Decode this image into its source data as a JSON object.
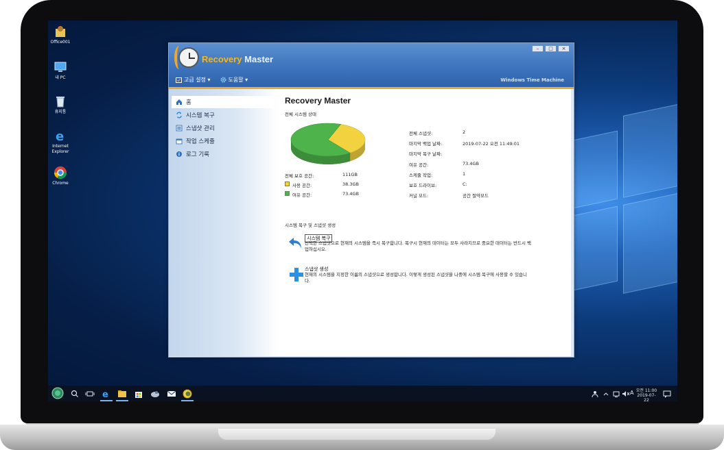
{
  "desktop": {
    "icons": [
      {
        "label": "Office001"
      },
      {
        "label": "내 PC"
      },
      {
        "label": "휴지통"
      },
      {
        "label": "Internet Explorer"
      },
      {
        "label": "Chrome"
      }
    ]
  },
  "app": {
    "title_part1": "Recovery",
    "title_part2": " Master",
    "tagline": "Windows Time Machine",
    "menu": [
      {
        "label": "고급 설정 ▾"
      },
      {
        "label": "도움말 ▾"
      }
    ],
    "window_controls": [
      "–",
      "□",
      "×"
    ]
  },
  "sidebar": {
    "items": [
      {
        "label": "홈",
        "active": true
      },
      {
        "label": "시스템 복구"
      },
      {
        "label": "스냅샷 관리"
      },
      {
        "label": "작업 스케줄"
      },
      {
        "label": "로그 기록"
      }
    ]
  },
  "main": {
    "title": "Recovery Master",
    "status_section": "전체 시스템 상태",
    "disk": {
      "total_label": "전체 보호 공간:",
      "total_value": "111GB",
      "used_label": "사용 공간:",
      "used_value": "38.3GB",
      "free_label": "여유 공간:",
      "free_value": "73.4GB",
      "used_color": "#f3d240",
      "free_color": "#4db34a"
    },
    "info": [
      {
        "label": "전체 스냅샷:",
        "value": "2"
      },
      {
        "label": "마지막 백업 날짜:",
        "value": "2019-07-22 오전 11:49:01"
      },
      {
        "label": "마지막 복구 날짜:",
        "value": ""
      },
      {
        "label": "여유 공간:",
        "value": "73.4GB"
      },
      {
        "label": "스케줄 작업:",
        "value": "1"
      },
      {
        "label": "보호 드라이브:",
        "value": "C:"
      },
      {
        "label": "커널 모드:",
        "value": "공간 절약모드"
      }
    ],
    "actions_section": "시스템 복구 및 스냅샷 생성",
    "actions": [
      {
        "title": "시스템 복구",
        "desc": "선택한 스냅샷으로 현재의 시스템을 즉시 복구합니다. 복구시 현재의 데이터는 모두 사라지므로 중요한 데이터는 반드시 백업하십시오."
      },
      {
        "title": "스냅샷 생성",
        "desc": "현재의 시스템을 지정한 이름의 스냅샷으로 생성합니다. 이렇게 생성된 스냅샷을 나중에 시스템 복구에 사용할 수 있습니다."
      }
    ]
  },
  "chart_data": {
    "type": "pie",
    "categories": [
      "사용 공간",
      "여유 공간"
    ],
    "values": [
      38.3,
      73.4
    ],
    "colors": [
      "#f3d240",
      "#4db34a"
    ]
  },
  "taskbar": {
    "time": "오전 11:00",
    "date": "2019-07-22",
    "ime": "A"
  }
}
